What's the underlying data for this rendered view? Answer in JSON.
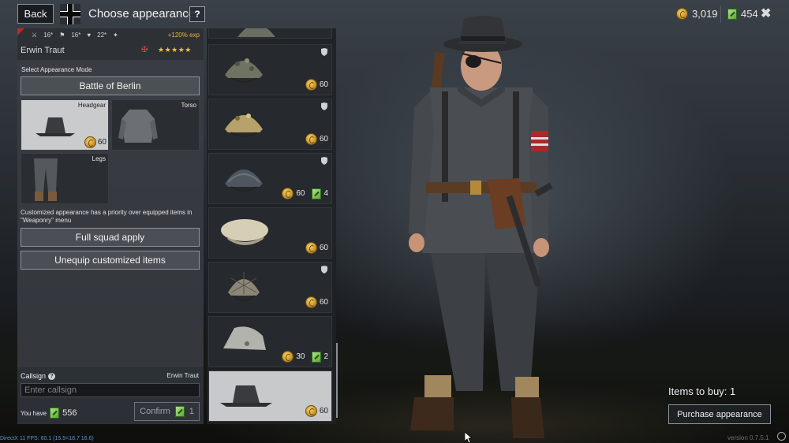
{
  "header": {
    "back_label": "Back",
    "title": "Choose appearance",
    "help_label": "?",
    "gold_amount": "3,019",
    "ticket_amount": "454",
    "close_label": "✖"
  },
  "soldier_card": {
    "stats": [
      "16*",
      "16*",
      "22*"
    ],
    "exp_bonus": "+120% exp",
    "name": "Erwin Traut",
    "stars": "★★★★★"
  },
  "appearance": {
    "mode_label": "Select Appearance Mode",
    "mode_value": "Battle of Berlin",
    "slots": [
      {
        "label": "Headgear",
        "price": "60",
        "selected": true
      },
      {
        "label": "Torso"
      },
      {
        "label": "Legs"
      }
    ],
    "note": "Customized appearance has a priority over equipped items in \"Weaponry\" menu",
    "full_squad_label": "Full squad apply",
    "unequip_label": "Unequip customized items"
  },
  "callsign": {
    "label": "Callsign",
    "name": "Erwin Traut",
    "placeholder": "Enter callsign",
    "you_have_label": "You have",
    "you_have_amount": "556",
    "confirm_label": "Confirm",
    "confirm_cost": "1"
  },
  "items": [
    {
      "name": "partial-helmet-item",
      "gold": "",
      "tickets": "",
      "shield": false
    },
    {
      "name": "camo-helmet-item",
      "gold": "60",
      "tickets": "",
      "shield": true
    },
    {
      "name": "tan-camo-helmet-item",
      "gold": "60",
      "tickets": "",
      "shield": true
    },
    {
      "name": "grey-helmet-item",
      "gold": "60",
      "tickets": "4",
      "shield": true
    },
    {
      "name": "cloth-cap-item",
      "gold": "60",
      "tickets": "",
      "shield": false
    },
    {
      "name": "net-helmet-item",
      "gold": "60",
      "tickets": "",
      "shield": true
    },
    {
      "name": "side-cap-item",
      "gold": "30",
      "tickets": "2",
      "shield": false
    },
    {
      "name": "fedora-hat-item",
      "gold": "60",
      "tickets": "",
      "shield": false,
      "selected": true
    }
  ],
  "purchase": {
    "items_to_buy": "Items to buy: 1",
    "purchase_label": "Purchase appearance"
  },
  "footer": {
    "status": "DirectX 11 FPS: 60.1 (15.5<18.7 16.6)",
    "version": "version 0.7.5.1"
  },
  "colors": {
    "gold": "#f2c233",
    "exp": "#e9b54a",
    "selected_slot": "#c9cbcd",
    "ticket_green": "#5aa832"
  }
}
